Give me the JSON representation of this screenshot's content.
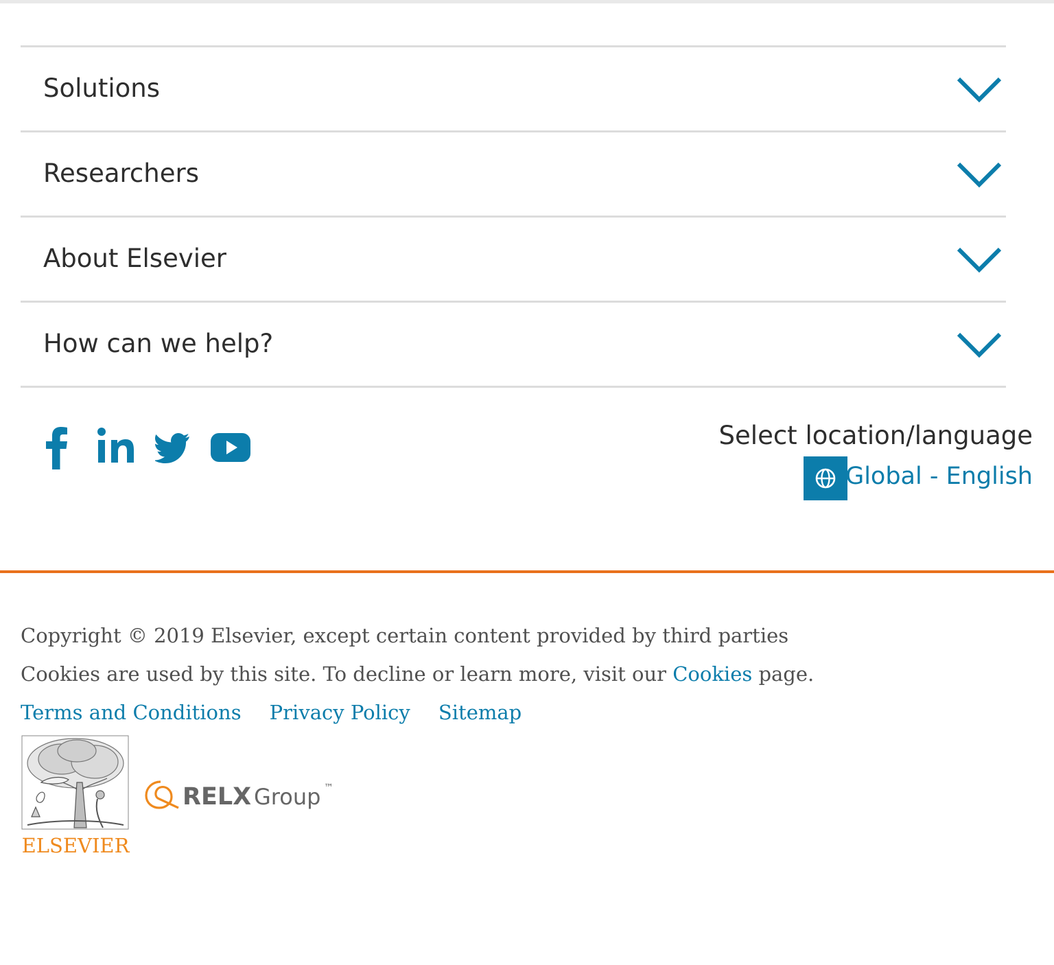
{
  "accordion": {
    "items": [
      {
        "label": "Solutions"
      },
      {
        "label": "Researchers"
      },
      {
        "label": "About Elsevier"
      },
      {
        "label": "How can we help?"
      }
    ]
  },
  "social": {
    "icons": [
      "facebook-icon",
      "linkedin-icon",
      "twitter-icon",
      "youtube-icon"
    ]
  },
  "location": {
    "title": "Select location/language",
    "current": "Global - English",
    "icon": "globe-icon"
  },
  "footer": {
    "copyright": "Copyright © 2019 Elsevier, except certain content provided by third parties",
    "cookies_prefix": "Cookies are used by this site. To decline or learn more, visit our",
    "cookies_link": "Cookies",
    "cookies_suffix": "page.",
    "links": [
      "Terms and Conditions",
      "Privacy Policy",
      "Sitemap"
    ]
  },
  "logos": {
    "elsevier_wordmark": "ELSEVIER",
    "relx_wordmark": "RELX",
    "relx_group": "Group",
    "relx_tm": "™"
  },
  "colors": {
    "accent": "#0c7dab",
    "orange": "#e9711c",
    "text": "#2e2e2e",
    "muted_text": "#505050",
    "divider": "#dcdcdc"
  }
}
